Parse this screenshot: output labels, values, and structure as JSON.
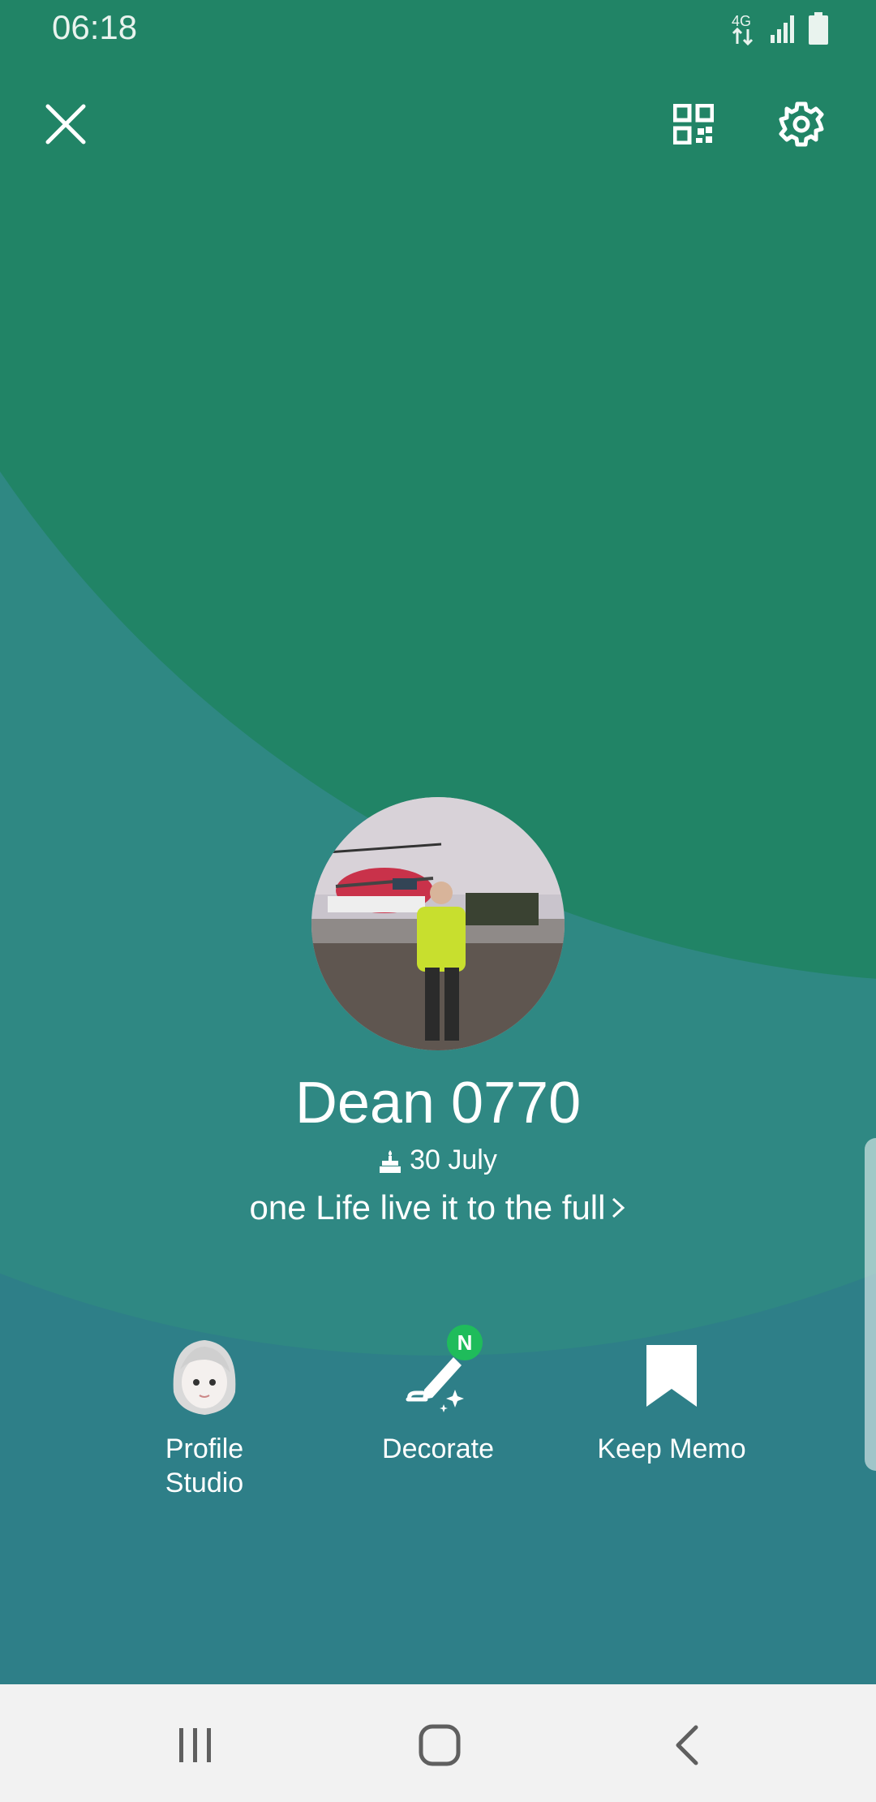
{
  "colors": {
    "top_green": "#218466",
    "lower_teal": "#2e7f88",
    "mid_teal": "#2f8883",
    "badge_green": "#1fbc5b",
    "nav_bg": "#f2f2f2"
  },
  "status_bar": {
    "time": "06:18",
    "network": "4G",
    "icons": [
      "4g-data-icon",
      "signal-icon",
      "battery-icon"
    ]
  },
  "toolbar": {
    "close_icon": "close-icon",
    "qr_icon": "qr-code-icon",
    "settings_icon": "gear-icon"
  },
  "profile": {
    "name": "Dean 0770",
    "birthday": "30 July",
    "status_message": "one Life live it to the full"
  },
  "actions": [
    {
      "label": "Profile\nStudio",
      "icon": "avatar-face-icon"
    },
    {
      "label": "Decorate",
      "icon": "pen-sparkle-icon",
      "badge": "N"
    },
    {
      "label": "Keep Memo",
      "icon": "bookmark-icon"
    }
  ],
  "nav": {
    "icons": [
      "recent-apps-icon",
      "home-icon",
      "back-icon"
    ]
  }
}
